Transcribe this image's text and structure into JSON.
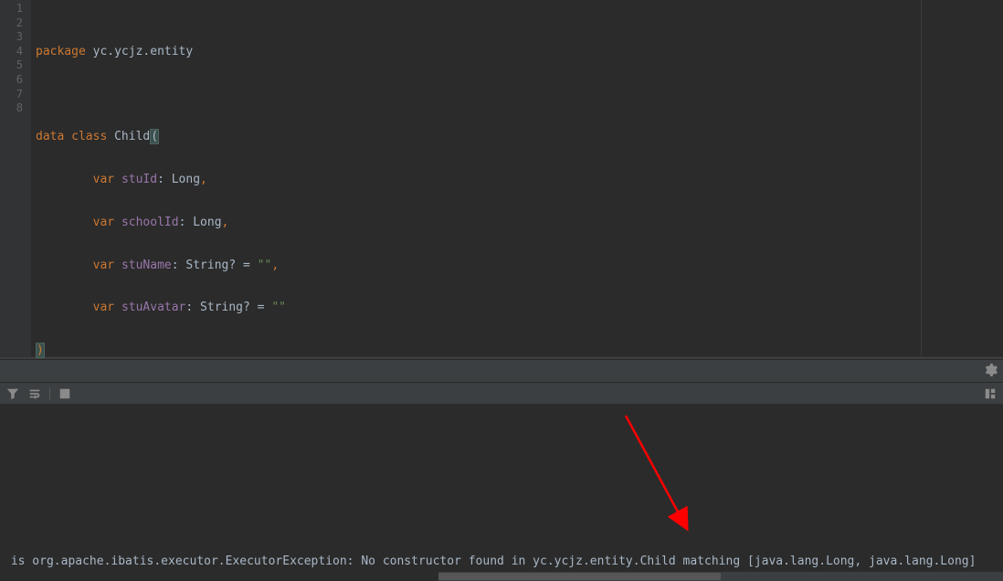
{
  "gutter": {
    "lines": [
      1,
      2,
      3,
      4,
      5,
      6,
      7,
      8
    ]
  },
  "code": {
    "l1": {
      "kw_package": "package",
      "pkg": "yc.ycjz.entity"
    },
    "l3": {
      "kw_data": "data",
      "kw_class": "class",
      "name": "Child",
      "paren": "("
    },
    "l4": {
      "kw_var": "var",
      "field": "stuId",
      "colon": ":",
      "type": "Long",
      "comma": ","
    },
    "l5": {
      "kw_var": "var",
      "field": "schoolId",
      "colon": ":",
      "type": "Long",
      "comma": ","
    },
    "l6": {
      "kw_var": "var",
      "field": "stuName",
      "colon": ":",
      "type": "String?",
      "eq": "=",
      "val": "\"\"",
      "comma": ","
    },
    "l7": {
      "kw_var": "var",
      "field": "stuAvatar",
      "colon": ":",
      "type": "String?",
      "eq": "=",
      "val": "\"\""
    },
    "l8": {
      "paren": ")"
    }
  },
  "console": {
    "line": " is org.apache.ibatis.executor.ExecutorException: No constructor found in yc.ycjz.entity.Child matching [java.lang.Long, java.lang.Long]"
  }
}
